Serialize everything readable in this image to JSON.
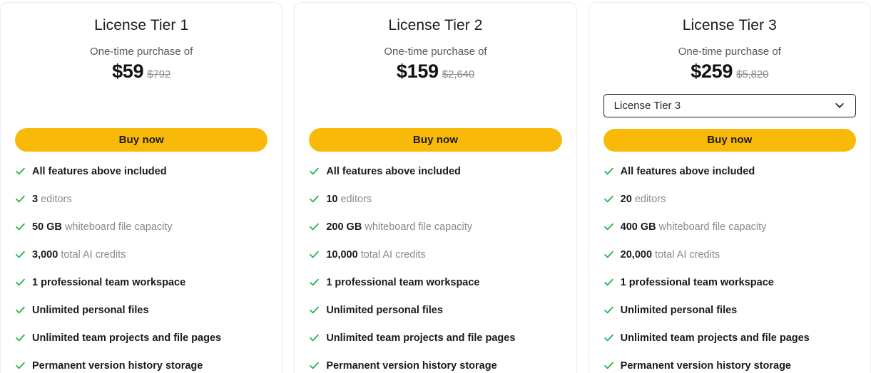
{
  "theme": {
    "accent": "#f9b908",
    "check_color": "#22b14c",
    "card_bg": "#ffffff",
    "page_bg": "#ffffff",
    "muted_text": "#8a8a8a",
    "strong_text": "#1a1a1a",
    "strikethrough_text": "#8b8b8b",
    "select_border": "#1f1f1f"
  },
  "cards": [
    {
      "title": "License Tier 1",
      "price_caption": "One-time purchase of",
      "price_now": "$59",
      "price_was": "$792",
      "has_select": false,
      "buy_label": "Buy now",
      "features": [
        {
          "strong": "All features above included",
          "rest": ""
        },
        {
          "strong": "3",
          "rest": " editors"
        },
        {
          "strong": "50 GB",
          "rest": " whiteboard file capacity"
        },
        {
          "strong": "3,000",
          "rest": " total AI credits"
        },
        {
          "strong": "1 professional team workspace",
          "rest": ""
        },
        {
          "strong": "Unlimited personal files",
          "rest": ""
        },
        {
          "strong": "Unlimited team projects and file pages",
          "rest": ""
        },
        {
          "strong": "Permanent version history storage",
          "rest": ""
        }
      ]
    },
    {
      "title": "License Tier 2",
      "price_caption": "One-time purchase of",
      "price_now": "$159",
      "price_was": "$2,640",
      "has_select": false,
      "buy_label": "Buy now",
      "features": [
        {
          "strong": "All features above included",
          "rest": ""
        },
        {
          "strong": "10",
          "rest": " editors"
        },
        {
          "strong": "200 GB",
          "rest": " whiteboard file capacity"
        },
        {
          "strong": "10,000",
          "rest": " total AI credits"
        },
        {
          "strong": "1 professional team workspace",
          "rest": ""
        },
        {
          "strong": "Unlimited personal files",
          "rest": ""
        },
        {
          "strong": "Unlimited team projects and file pages",
          "rest": ""
        },
        {
          "strong": "Permanent version history storage",
          "rest": ""
        }
      ]
    },
    {
      "title": "License Tier 3",
      "price_caption": "One-time purchase of",
      "price_now": "$259",
      "price_was": "$5,820",
      "has_select": true,
      "select_value": "License Tier 3",
      "select_icon": "chevron-down-icon",
      "buy_label": "Buy now",
      "features": [
        {
          "strong": "All features above included",
          "rest": ""
        },
        {
          "strong": "20",
          "rest": " editors"
        },
        {
          "strong": "400 GB",
          "rest": " whiteboard file capacity"
        },
        {
          "strong": "20,000",
          "rest": " total AI credits"
        },
        {
          "strong": "1 professional team workspace",
          "rest": ""
        },
        {
          "strong": "Unlimited personal files",
          "rest": ""
        },
        {
          "strong": "Unlimited team projects and file pages",
          "rest": ""
        },
        {
          "strong": "Permanent version history storage",
          "rest": ""
        }
      ]
    }
  ]
}
